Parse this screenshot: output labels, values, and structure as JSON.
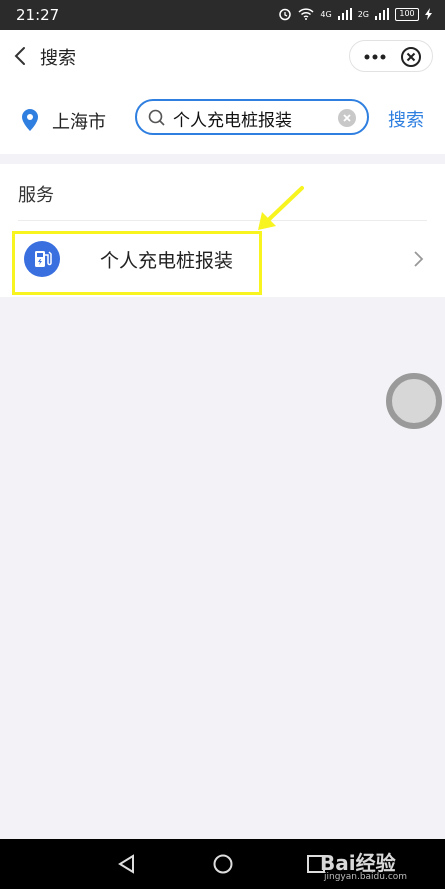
{
  "status_bar": {
    "time": "21:27",
    "signal_1": "4G",
    "signal_2": "2G",
    "battery": "100"
  },
  "header": {
    "title": "搜索",
    "icons": [
      "chevron-left-icon",
      "more-icon",
      "close-circle-icon"
    ]
  },
  "search": {
    "city": "上海市",
    "query": "个人充电桩报装",
    "button_label": "搜索"
  },
  "services": {
    "section_title": "服务",
    "items": [
      {
        "name": "个人充电桩报装",
        "icon": "charging-pile-icon"
      }
    ]
  },
  "annotation": {
    "highlight_color": "#f7f420"
  },
  "colors": {
    "accent": "#2f7fe0",
    "service_icon_bg": "#3a6fe0",
    "background": "#f3f2f6"
  },
  "watermark": {
    "brand": "Bai经验",
    "url": "jingyan.baidu.com"
  }
}
